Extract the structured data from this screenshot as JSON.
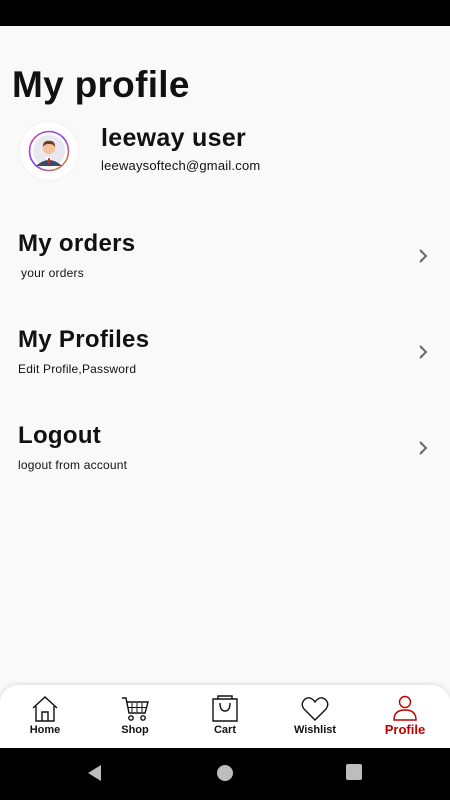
{
  "page": {
    "title": "My profile"
  },
  "user": {
    "name": "leeway user",
    "email": "leewaysoftech@gmail.com"
  },
  "menu": [
    {
      "title": "My orders",
      "subtitle": "your orders"
    },
    {
      "title": "My Profiles",
      "subtitle": "Edit Profile,Password"
    },
    {
      "title": "Logout",
      "subtitle": "logout from account"
    }
  ],
  "bottom_nav": {
    "active": "Profile",
    "items": [
      {
        "label": "Home",
        "icon": "home-icon"
      },
      {
        "label": "Shop",
        "icon": "cart-icon"
      },
      {
        "label": "Cart",
        "icon": "shopping-bag-icon"
      },
      {
        "label": "Wishlist",
        "icon": "heart-icon"
      },
      {
        "label": "Profile",
        "icon": "person-icon"
      }
    ]
  },
  "system_nav": [
    "back-icon",
    "home-circle-icon",
    "recents-icon"
  ],
  "colors": {
    "accent": "#c00000",
    "background": "#f9f9f9",
    "text": "#111111",
    "chevron": "#666666"
  }
}
